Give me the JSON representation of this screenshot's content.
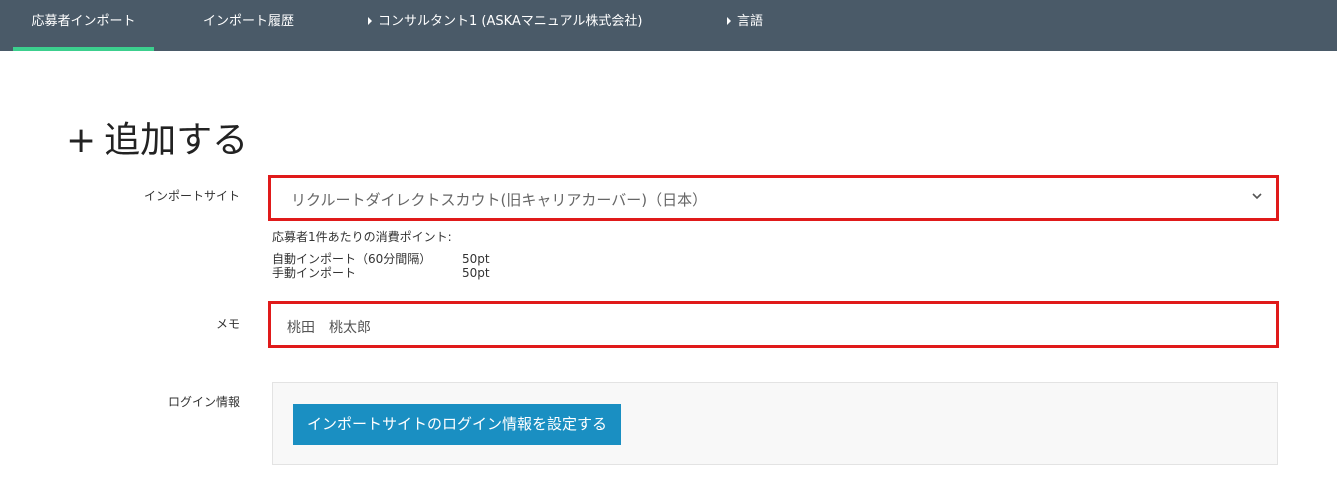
{
  "nav": {
    "items": [
      {
        "label": "応募者インポート",
        "active": true
      },
      {
        "label": "インポート履歴"
      },
      {
        "label": "コンサルタント1 (ASKAマニュアル株式会社)"
      },
      {
        "label": "言語"
      }
    ],
    "active_color": "#3ccf8e",
    "background": "#4a5a68"
  },
  "page": {
    "title_icon": "+",
    "title": "追加する"
  },
  "form": {
    "import_site": {
      "label": "インポートサイト",
      "value": "リクルートダイレクトスカウト(旧キャリアカーバー)（日本）"
    },
    "points": {
      "heading": "応募者1件あたりの消費ポイント:",
      "auto_label": "自動インポート（60分間隔）",
      "auto_value": "50pt",
      "manual_label": "手動インポート",
      "manual_value": "50pt"
    },
    "memo": {
      "label": "メモ",
      "value": "桃田　桃太郎"
    },
    "login": {
      "label": "ログイン情報",
      "button_label": "インポートサイトのログイン情報を設定する"
    }
  },
  "colors": {
    "highlight_border": "#e01a1a",
    "primary_button": "#1a8fc2"
  }
}
